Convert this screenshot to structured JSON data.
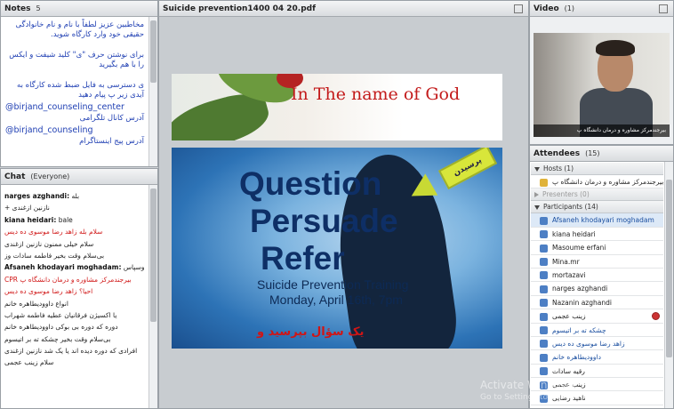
{
  "notes": {
    "title": "Notes",
    "count": "5",
    "lines": [
      "مخاطبین عزیز لطفاً با نام و نام خانوادگی حقیقی خود وارد کارگاه شوید.",
      "برای نوشتن حرف \"ی\" کلید شیفت و ایکس را با هم بگیرید",
      "ی دسترسی به فایل ضبط شده کارگاه به آیدی زیر پ پیام دهید"
    ],
    "handle1": "@birjand_counseling_center",
    "label1": "آدرس کانال تلگرامی",
    "handle2": "@birjand_counseling",
    "label2": "آدرس پیج اینستاگرام"
  },
  "chat": {
    "title": "Chat",
    "scope": "(Everyone)",
    "messages": [
      {
        "sender": "narges azghandi:",
        "text": "بله"
      },
      {
        "sender": "",
        "text": "+ نازنین ازغندی"
      },
      {
        "sender": "kiana heidari:",
        "text": "bale"
      },
      {
        "sender": "",
        "text": "سلام بله  زاهد رضا موسوی ده دیس"
      },
      {
        "sender": "",
        "text": "سلام خیلی ممنون  نازنین ازغندی"
      },
      {
        "sender": "",
        "text": "بی‌سلام وقت بخیر  فاطمه سادات وز"
      },
      {
        "sender": "Afsaneh khodayari moghadam:",
        "text": "باسلام وسپاس"
      },
      {
        "sender": "",
        "text": "CPR  بیرجندمرکز مشاوره و درمان دانشگاه پ"
      },
      {
        "sender": "",
        "text": "احیا؟  زاهد رضا موسوی ده دیس"
      },
      {
        "sender": "",
        "text": "انواع  داوودیطاهره خانم"
      },
      {
        "sender": "",
        "text": "یا اکسیژن  فرقانیان عطیه فاطمه شهراب"
      },
      {
        "sender": "",
        "text": "دوره که دوره  بی بوکی  داوودیطاهره خانم"
      },
      {
        "sender": "",
        "text": "بی‌سلام وقت بخیر  چشکه ته بر اتیسوم"
      },
      {
        "sender": "",
        "text": "افرادی که دوره دیده اند یا یک شد  نازنین ازغندی"
      },
      {
        "sender": "",
        "text": "سلام  زینب عجمی"
      }
    ]
  },
  "share": {
    "title": "Suicide prevention1400 04 20.pdf",
    "slide_heading": "In The name of  God",
    "word1": "Question",
    "word2": "Persuade",
    "word3": "Refer",
    "subtitle1": "Suicide Prevention Training",
    "subtitle2": "Monday, April 16th, 7pm",
    "badge": "پرسیدن",
    "persian_line": "یک سؤال بپرسید و"
  },
  "video": {
    "title": "Video",
    "count": "(1)",
    "caption": "بیرجندمرکز مشاوره و درمان دانشگاه پ"
  },
  "attendees": {
    "title": "Attendees",
    "count": "(15)",
    "hosts_label": "Hosts (1)",
    "host_name": "بیرجندمرکز مشاوره و درمان دانشگاه پ",
    "presenters_label": "Presenters (0)",
    "participants_label": "Participants (14)",
    "participants": [
      "Afsaneh khodayari moghadam",
      "kiana heidari",
      "Masoume erfani",
      "Mina.mr",
      "mortazavi",
      "narges azghandi",
      "Nazanin azghandi",
      "زینب عجمی",
      "چشکه ته بر اتیسوم",
      "زاهد رضا موسوی ده دیس",
      "داوودیطاهره خانم",
      "رقیه سادات",
      "زینب عجمی",
      "ناهید رضایی"
    ]
  },
  "watermark": {
    "line1": "Activate Windows",
    "line2": "Go to Settings to activate Windows."
  }
}
